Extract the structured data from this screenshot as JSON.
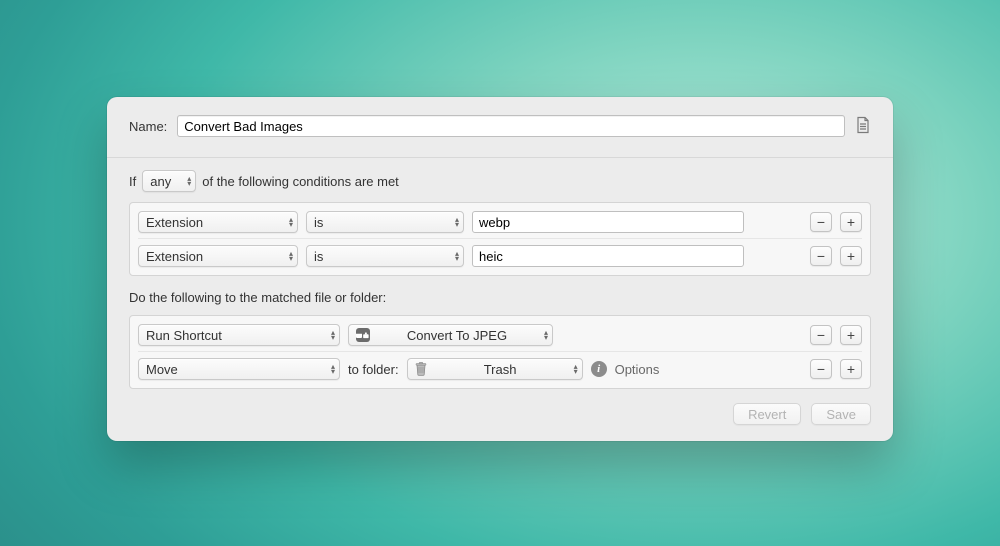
{
  "name": {
    "label": "Name:",
    "value": "Convert Bad Images"
  },
  "if": {
    "prefix": "If",
    "quantifier": "any",
    "suffix": "of the following conditions are met"
  },
  "conditions": [
    {
      "attr": "Extension",
      "op": "is",
      "value": "webp"
    },
    {
      "attr": "Extension",
      "op": "is",
      "value": "heic"
    }
  ],
  "actions_label": "Do the following to the matched file or folder:",
  "actions": {
    "shortcut": {
      "action": "Run Shortcut",
      "target": "Convert To JPEG"
    },
    "move": {
      "action": "Move",
      "to_label": "to folder:",
      "target": "Trash",
      "options_label": "Options"
    }
  },
  "footer": {
    "revert": "Revert",
    "save": "Save"
  }
}
